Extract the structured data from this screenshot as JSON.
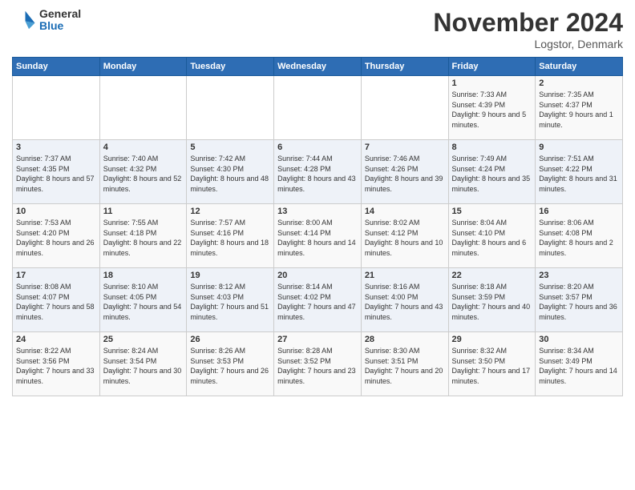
{
  "logo": {
    "general": "General",
    "blue": "Blue"
  },
  "header": {
    "title": "November 2024",
    "location": "Logstor, Denmark"
  },
  "weekdays": [
    "Sunday",
    "Monday",
    "Tuesday",
    "Wednesday",
    "Thursday",
    "Friday",
    "Saturday"
  ],
  "weeks": [
    [
      {
        "day": "",
        "info": ""
      },
      {
        "day": "",
        "info": ""
      },
      {
        "day": "",
        "info": ""
      },
      {
        "day": "",
        "info": ""
      },
      {
        "day": "",
        "info": ""
      },
      {
        "day": "1",
        "info": "Sunrise: 7:33 AM\nSunset: 4:39 PM\nDaylight: 9 hours and 5 minutes."
      },
      {
        "day": "2",
        "info": "Sunrise: 7:35 AM\nSunset: 4:37 PM\nDaylight: 9 hours and 1 minute."
      }
    ],
    [
      {
        "day": "3",
        "info": "Sunrise: 7:37 AM\nSunset: 4:35 PM\nDaylight: 8 hours and 57 minutes."
      },
      {
        "day": "4",
        "info": "Sunrise: 7:40 AM\nSunset: 4:32 PM\nDaylight: 8 hours and 52 minutes."
      },
      {
        "day": "5",
        "info": "Sunrise: 7:42 AM\nSunset: 4:30 PM\nDaylight: 8 hours and 48 minutes."
      },
      {
        "day": "6",
        "info": "Sunrise: 7:44 AM\nSunset: 4:28 PM\nDaylight: 8 hours and 43 minutes."
      },
      {
        "day": "7",
        "info": "Sunrise: 7:46 AM\nSunset: 4:26 PM\nDaylight: 8 hours and 39 minutes."
      },
      {
        "day": "8",
        "info": "Sunrise: 7:49 AM\nSunset: 4:24 PM\nDaylight: 8 hours and 35 minutes."
      },
      {
        "day": "9",
        "info": "Sunrise: 7:51 AM\nSunset: 4:22 PM\nDaylight: 8 hours and 31 minutes."
      }
    ],
    [
      {
        "day": "10",
        "info": "Sunrise: 7:53 AM\nSunset: 4:20 PM\nDaylight: 8 hours and 26 minutes."
      },
      {
        "day": "11",
        "info": "Sunrise: 7:55 AM\nSunset: 4:18 PM\nDaylight: 8 hours and 22 minutes."
      },
      {
        "day": "12",
        "info": "Sunrise: 7:57 AM\nSunset: 4:16 PM\nDaylight: 8 hours and 18 minutes."
      },
      {
        "day": "13",
        "info": "Sunrise: 8:00 AM\nSunset: 4:14 PM\nDaylight: 8 hours and 14 minutes."
      },
      {
        "day": "14",
        "info": "Sunrise: 8:02 AM\nSunset: 4:12 PM\nDaylight: 8 hours and 10 minutes."
      },
      {
        "day": "15",
        "info": "Sunrise: 8:04 AM\nSunset: 4:10 PM\nDaylight: 8 hours and 6 minutes."
      },
      {
        "day": "16",
        "info": "Sunrise: 8:06 AM\nSunset: 4:08 PM\nDaylight: 8 hours and 2 minutes."
      }
    ],
    [
      {
        "day": "17",
        "info": "Sunrise: 8:08 AM\nSunset: 4:07 PM\nDaylight: 7 hours and 58 minutes."
      },
      {
        "day": "18",
        "info": "Sunrise: 8:10 AM\nSunset: 4:05 PM\nDaylight: 7 hours and 54 minutes."
      },
      {
        "day": "19",
        "info": "Sunrise: 8:12 AM\nSunset: 4:03 PM\nDaylight: 7 hours and 51 minutes."
      },
      {
        "day": "20",
        "info": "Sunrise: 8:14 AM\nSunset: 4:02 PM\nDaylight: 7 hours and 47 minutes."
      },
      {
        "day": "21",
        "info": "Sunrise: 8:16 AM\nSunset: 4:00 PM\nDaylight: 7 hours and 43 minutes."
      },
      {
        "day": "22",
        "info": "Sunrise: 8:18 AM\nSunset: 3:59 PM\nDaylight: 7 hours and 40 minutes."
      },
      {
        "day": "23",
        "info": "Sunrise: 8:20 AM\nSunset: 3:57 PM\nDaylight: 7 hours and 36 minutes."
      }
    ],
    [
      {
        "day": "24",
        "info": "Sunrise: 8:22 AM\nSunset: 3:56 PM\nDaylight: 7 hours and 33 minutes."
      },
      {
        "day": "25",
        "info": "Sunrise: 8:24 AM\nSunset: 3:54 PM\nDaylight: 7 hours and 30 minutes."
      },
      {
        "day": "26",
        "info": "Sunrise: 8:26 AM\nSunset: 3:53 PM\nDaylight: 7 hours and 26 minutes."
      },
      {
        "day": "27",
        "info": "Sunrise: 8:28 AM\nSunset: 3:52 PM\nDaylight: 7 hours and 23 minutes."
      },
      {
        "day": "28",
        "info": "Sunrise: 8:30 AM\nSunset: 3:51 PM\nDaylight: 7 hours and 20 minutes."
      },
      {
        "day": "29",
        "info": "Sunrise: 8:32 AM\nSunset: 3:50 PM\nDaylight: 7 hours and 17 minutes."
      },
      {
        "day": "30",
        "info": "Sunrise: 8:34 AM\nSunset: 3:49 PM\nDaylight: 7 hours and 14 minutes."
      }
    ]
  ]
}
